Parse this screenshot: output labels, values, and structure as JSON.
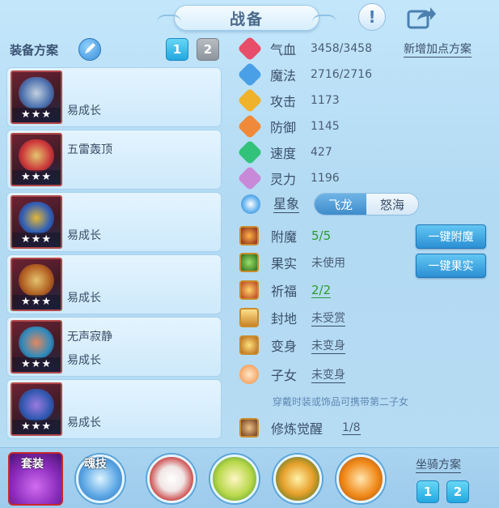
{
  "title": "战备",
  "header": {
    "help_glyph": "!",
    "help_icon": "exclamation-icon",
    "share_icon": "share-icon"
  },
  "equip_plan": {
    "label": "装备方案",
    "tabs": [
      "1",
      "2"
    ],
    "active_tab": "1",
    "items": [
      {
        "name": "",
        "note": "易成长",
        "stars": "★★★"
      },
      {
        "name": "五雷轰顶",
        "note": "",
        "stars": "★★★"
      },
      {
        "name": "",
        "note": "易成长",
        "stars": "★★★"
      },
      {
        "name": "",
        "note": "易成长",
        "stars": "★★★"
      },
      {
        "name": "无声寂静",
        "note": "易成长",
        "stars": "★★★"
      },
      {
        "name": "",
        "note": "易成长",
        "stars": "★★★"
      }
    ]
  },
  "attributes": [
    {
      "label": "气血",
      "value": "3458/3458",
      "color": "#e84d6a"
    },
    {
      "label": "魔法",
      "value": "2716/2716",
      "color": "#4aa0e6"
    },
    {
      "label": "攻击",
      "value": "1173",
      "color": "#f0b22a"
    },
    {
      "label": "防御",
      "value": "1145",
      "color": "#f08a3a"
    },
    {
      "label": "速度",
      "value": "427",
      "color": "#32c27a"
    },
    {
      "label": "灵力",
      "value": "1196",
      "color": "#c88ad8"
    }
  ],
  "new_point_plan": "新增加点方案",
  "star": {
    "label": "星象",
    "options": [
      "飞龙",
      "怒海"
    ],
    "selected": "怒海"
  },
  "extras": [
    {
      "label": "附魔",
      "value": "5/5",
      "style": "green"
    },
    {
      "label": "果实",
      "value": "未使用",
      "style": "plain"
    },
    {
      "label": "祈福",
      "value": "2/2",
      "style": "green"
    },
    {
      "label": "封地",
      "value": "未受赏",
      "style": "link"
    },
    {
      "label": "变身",
      "value": "未变身",
      "style": "link"
    },
    {
      "label": "子女",
      "value": "未变身",
      "style": "link"
    }
  ],
  "buttons": {
    "enchant_all": "一键附魔",
    "fruit_all": "一键果实"
  },
  "hint": "穿戴时装或饰品可携带第二子女",
  "cultivation": {
    "label": "修炼觉醒",
    "value": "1/8"
  },
  "bottom": {
    "suit_tab": "套装",
    "soul_tab": "魂技",
    "mount_plan": "坐骑方案",
    "mount_tabs": [
      "1",
      "2"
    ]
  }
}
